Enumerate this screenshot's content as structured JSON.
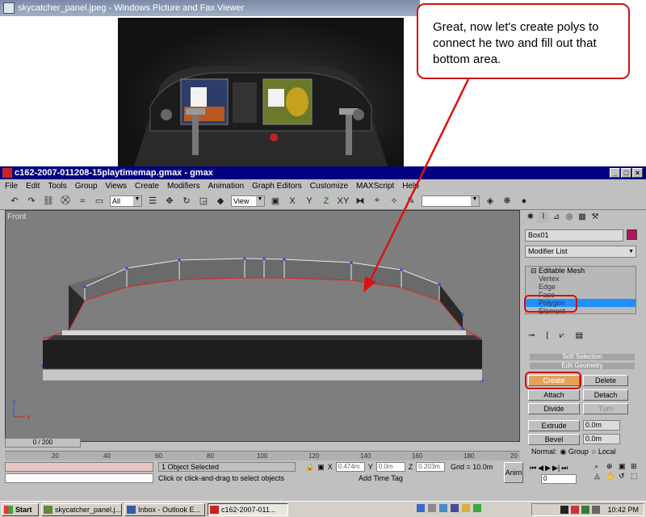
{
  "viewer": {
    "title": "skycatcher_panel.jpeg - Windows Picture and Fax Viewer"
  },
  "callout": {
    "text": "Great, now let's create polys to connect he two and fill out that bottom area."
  },
  "gmax": {
    "title": "c162-2007-011208-15playtimemap.gmax - gmax",
    "menu": [
      "File",
      "Edit",
      "Tools",
      "Group",
      "Views",
      "Create",
      "Modifiers",
      "Animation",
      "Graph Editors",
      "Customize",
      "MAXScript",
      "Help"
    ],
    "toolbar": {
      "filter_value": "All",
      "refcoord_value": "View"
    },
    "viewport_label": "Front",
    "axis_labels": {
      "z": "z",
      "x": "x"
    }
  },
  "command_panel": {
    "object_name": "Box01",
    "modifier_list": "Modifier List",
    "object_color": "#b0145c",
    "stack": {
      "root": "Editable Mesh",
      "items": [
        "Vertex",
        "Edge",
        "Face",
        "Polygon",
        "Element"
      ],
      "selected_index": 3
    },
    "rollouts": {
      "soft_selection": "Soft Selection",
      "edit_geometry": "Edit Geometry"
    },
    "buttons": {
      "create": "Create",
      "delete": "Delete",
      "attach": "Attach",
      "detach": "Detach",
      "divide": "Divide",
      "turn": "Turn",
      "extrude": "Extrude",
      "bevel": "Bevel"
    },
    "extrude_value": "0.0m",
    "bevel_value": "0.0m",
    "normal_label": "Normal:",
    "normal_group": "Group",
    "normal_local": "Local"
  },
  "timeline": {
    "slider_text": "0 / 200",
    "ticks": [
      "20",
      "40",
      "60",
      "80",
      "100",
      "120",
      "140",
      "160",
      "180",
      "20"
    ]
  },
  "status": {
    "selection": "1 Object Selected",
    "prompt": "Click or click-and-drag to select objects",
    "x_label": "X",
    "x_value": "0.474m",
    "y_label": "Y",
    "y_value": "0.0m",
    "z_label": "Z",
    "z_value": "0.203m",
    "grid": "Grid = 10.0m",
    "add_time_tag": "Add Time Tag",
    "anim_btn": "Anim",
    "frame_value": "0"
  },
  "taskbar": {
    "start": "Start",
    "tasks": [
      "skycatcher_panel.j...",
      "Inbox - Outlook E...",
      "c162-2007-011..."
    ],
    "active_index": 2,
    "time": "10:42 PM"
  }
}
